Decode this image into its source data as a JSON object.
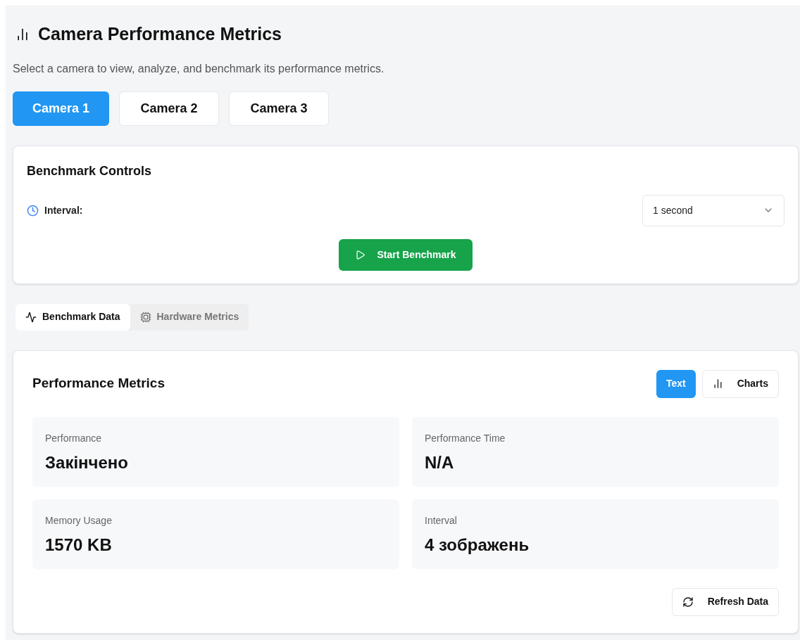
{
  "header": {
    "title": "Camera Performance Metrics",
    "subtitle": "Select a camera to view, analyze, and benchmark its performance metrics."
  },
  "cameras": [
    {
      "label": "Camera 1",
      "selected": true
    },
    {
      "label": "Camera 2",
      "selected": false
    },
    {
      "label": "Camera 3",
      "selected": false
    }
  ],
  "controls": {
    "title": "Benchmark Controls",
    "interval_label": "Interval:",
    "interval_value": "1 second",
    "start_button": "Start Benchmark"
  },
  "tabs": [
    {
      "label": "Benchmark Data",
      "kind": "activity",
      "selected": true
    },
    {
      "label": "Hardware Metrics",
      "kind": "chip",
      "selected": false
    }
  ],
  "metrics": {
    "title": "Performance Metrics",
    "view_toggle": [
      {
        "label": "Text",
        "kind": "text",
        "selected": true
      },
      {
        "label": "Charts",
        "kind": "chart",
        "selected": false
      }
    ],
    "cards": [
      {
        "label": "Performance",
        "value": "Закінчено"
      },
      {
        "label": "Performance Time",
        "value": "N/A"
      },
      {
        "label": "Memory Usage",
        "value": "1570 KB"
      },
      {
        "label": "Interval",
        "value": "4 зображень"
      }
    ],
    "refresh_button": "Refresh Data"
  }
}
